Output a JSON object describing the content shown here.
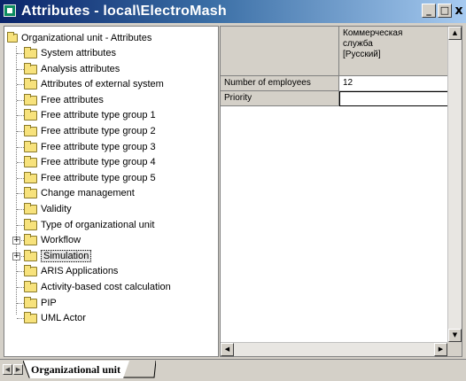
{
  "window": {
    "title": "Attributes - local\\ElectroMash",
    "buttons": {
      "minimize": "_",
      "maximize": "□",
      "close": "x"
    }
  },
  "tree": {
    "root_label": "Organizational unit - Attributes",
    "items": [
      {
        "label": "System attributes",
        "expandable": false
      },
      {
        "label": "Analysis attributes",
        "expandable": false
      },
      {
        "label": "Attributes of external system",
        "expandable": false
      },
      {
        "label": "Free attributes",
        "expandable": false
      },
      {
        "label": "Free attribute type group 1",
        "expandable": false
      },
      {
        "label": "Free attribute type group 2",
        "expandable": false
      },
      {
        "label": "Free attribute type group 3",
        "expandable": false
      },
      {
        "label": "Free attribute type group 4",
        "expandable": false
      },
      {
        "label": "Free attribute type group 5",
        "expandable": false
      },
      {
        "label": "Change management",
        "expandable": false
      },
      {
        "label": "Validity",
        "expandable": false
      },
      {
        "label": "Type of organizational unit",
        "expandable": false
      },
      {
        "label": "Workflow",
        "expandable": true
      },
      {
        "label": "Simulation",
        "expandable": true,
        "selected": true
      },
      {
        "label": "ARIS Applications",
        "expandable": false
      },
      {
        "label": "Activity-based cost calculation",
        "expandable": false
      },
      {
        "label": "PIP",
        "expandable": false
      },
      {
        "label": "UML Actor",
        "expandable": false
      }
    ]
  },
  "grid": {
    "column_header": [
      "Коммерческая",
      "служба",
      "[Русский]"
    ],
    "rows": [
      {
        "name": "Number of employees",
        "value": "12"
      },
      {
        "name": "Priority",
        "value": ""
      }
    ]
  },
  "tabs": {
    "active": "Organizational unit"
  },
  "colors": {
    "titlebar_start": "#0a246a",
    "titlebar_end": "#a6caf0",
    "folder": "#f7e27c",
    "chrome": "#d4d0c8"
  }
}
